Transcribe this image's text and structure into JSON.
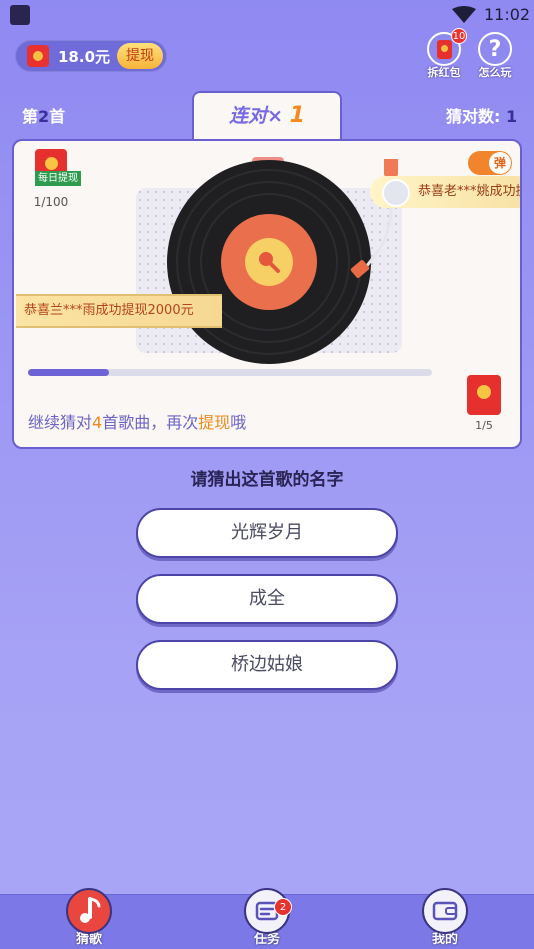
{
  "status_bar": {
    "time": "11:02"
  },
  "balance": {
    "amount": "18.0元",
    "withdraw_label": "提现"
  },
  "top_icons": {
    "red_packet": {
      "label": "拆红包",
      "badge": "10"
    },
    "how_to_play": {
      "label": "怎么玩"
    }
  },
  "header": {
    "song_prefix": "第",
    "song_number": "2",
    "song_suffix": "首",
    "streak_label": "连对×",
    "streak_value": "1",
    "guess_label": "猜对数:",
    "guess_value": "1"
  },
  "card": {
    "daily_withdraw": {
      "tag": "每日提现",
      "progress": "1/100"
    },
    "toggle_label": "弹",
    "marquee_right": "恭喜老***姚成功提现",
    "marquee_left": "恭喜兰***雨成功提现2000元",
    "progress_fraction": 0.2,
    "hint": {
      "part1": "继续猜对",
      "count": "4",
      "part2": "首歌曲，再次",
      "highlight": "提现",
      "part3": "哦"
    },
    "envelope_count": "1/5"
  },
  "question": "请猜出这首歌的名字",
  "options": [
    "光辉岁月",
    "成全",
    "桥边姑娘"
  ],
  "nav": {
    "guess": "猜歌",
    "tasks": "任务",
    "tasks_badge": "2",
    "mine": "我的"
  },
  "colors": {
    "background": "#9b96f3",
    "accent": "#6a5fd1",
    "orange": "#f08a1c",
    "red": "#e6302d"
  }
}
